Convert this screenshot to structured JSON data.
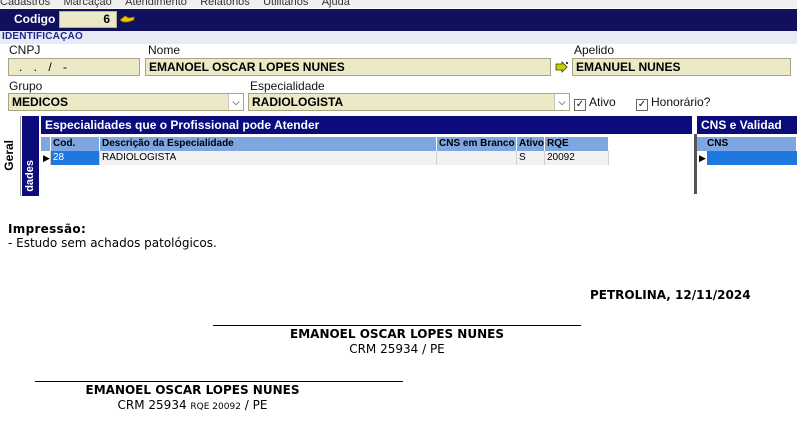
{
  "menu": [
    "Cadastros",
    "Marcação",
    "Atendimento",
    "Relatórios",
    "Utilitários",
    "Ajuda"
  ],
  "header": {
    "codigo_label": "Codigo",
    "codigo_value": "6"
  },
  "identificacao": {
    "section_label": "IDENTIFICAÇÃO",
    "cnpj_label": "CNPJ",
    "cnpj_value": ". . /  -",
    "nome_label": "Nome",
    "nome_value": "EMANOEL OSCAR LOPES NUNES",
    "apelido_label": "Apelido",
    "apelido_value": "EMANUEL NUNES",
    "grupo_label": "Grupo",
    "grupo_value": "MEDICOS",
    "especialidade_label": "Especialidade",
    "especialidade_value": "RADIOLOGISTA",
    "ativo_label": "Ativo",
    "ativo_checked": true,
    "honorario_label": "Honorário?",
    "honorario_checked": true
  },
  "side_tabs": [
    "Geral",
    "dades"
  ],
  "especialidades": {
    "title": "Especialidades que o Profissional pode Atender",
    "columns": [
      "Cod. Esp.",
      "Descrição da Especialidade",
      "CNS em Branco",
      "Ativo",
      "RQE"
    ],
    "rows": [
      {
        "cod": "28",
        "descricao": "RADIOLOGISTA",
        "cns_branco": "",
        "ativo": "S",
        "rqe": "20092"
      }
    ]
  },
  "cns_panel": {
    "title": "CNS e Validad",
    "column": "CNS"
  },
  "report": {
    "impressao_title": "Impressão:",
    "impressao_text": "- Estudo sem achados patológicos.",
    "city_date": "PETROLINA, 12/11/2024",
    "signature1": {
      "name": "EMANOEL OSCAR LOPES NUNES",
      "crm": "CRM 25934 / PE"
    },
    "signature2": {
      "name": "EMANOEL OSCAR LOPES NUNES",
      "crm_prefix": "CRM 25934",
      "rqe": "RQE 20092",
      "crm_suffix": "/ PE"
    }
  },
  "colors": {
    "header_navy": "#10105e",
    "grid_header": "#0b0b7c",
    "column_blue": "#7ea6e0",
    "field_bg": "#ece9c6",
    "selection_blue": "#1e78e0"
  }
}
